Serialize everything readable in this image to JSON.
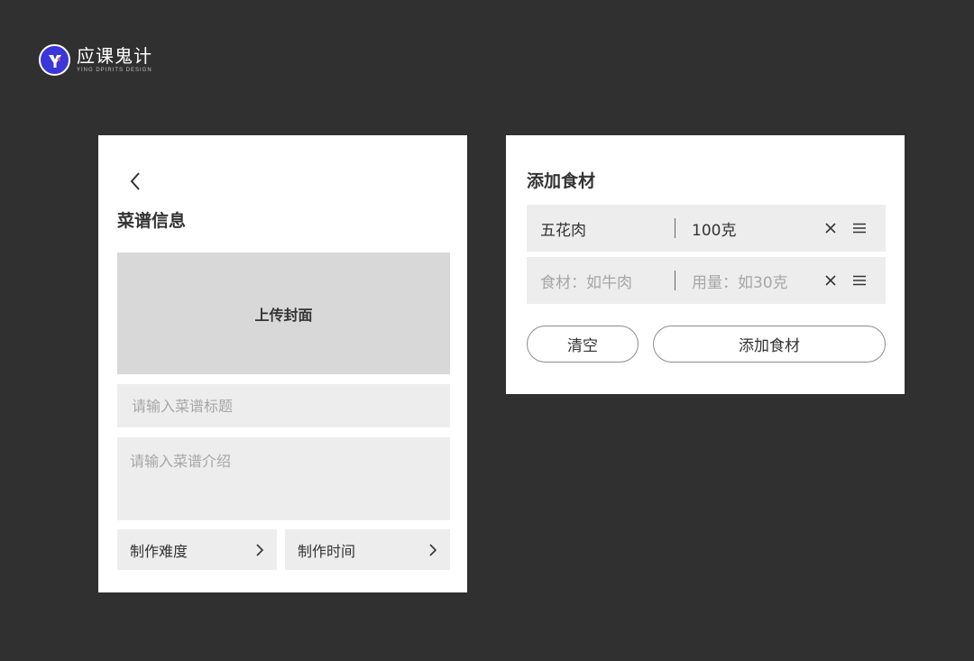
{
  "brand": {
    "name": "应课鬼计",
    "subtitle": "YING DPIRITS DESIGN",
    "accent_color": "#3a36d9"
  },
  "recipe_form": {
    "back_icon": "chevron-left-icon",
    "title": "菜谱信息",
    "cover_label": "上传封面",
    "title_placeholder": "请输入菜谱标题",
    "intro_placeholder": "请输入菜谱介绍",
    "difficulty_label": "制作难度",
    "time_label": "制作时间",
    "arrow_icon": "chevron-right-icon"
  },
  "ingredients": {
    "title": "添加食材",
    "rows": [
      {
        "name": "五花肉",
        "amount": "100克",
        "placeholder": false
      },
      {
        "name": "食材：如牛肉",
        "amount": "用量：如30克",
        "placeholder": true
      }
    ],
    "remove_icon": "close-icon",
    "drag_icon": "drag-handle-icon",
    "clear_label": "清空",
    "add_label": "添加食材"
  },
  "colors": {
    "background": "#303030",
    "card": "#ffffff",
    "field": "#ededed",
    "cover": "#d8d8d8",
    "text": "#333333",
    "placeholder": "#a6a6a6"
  }
}
